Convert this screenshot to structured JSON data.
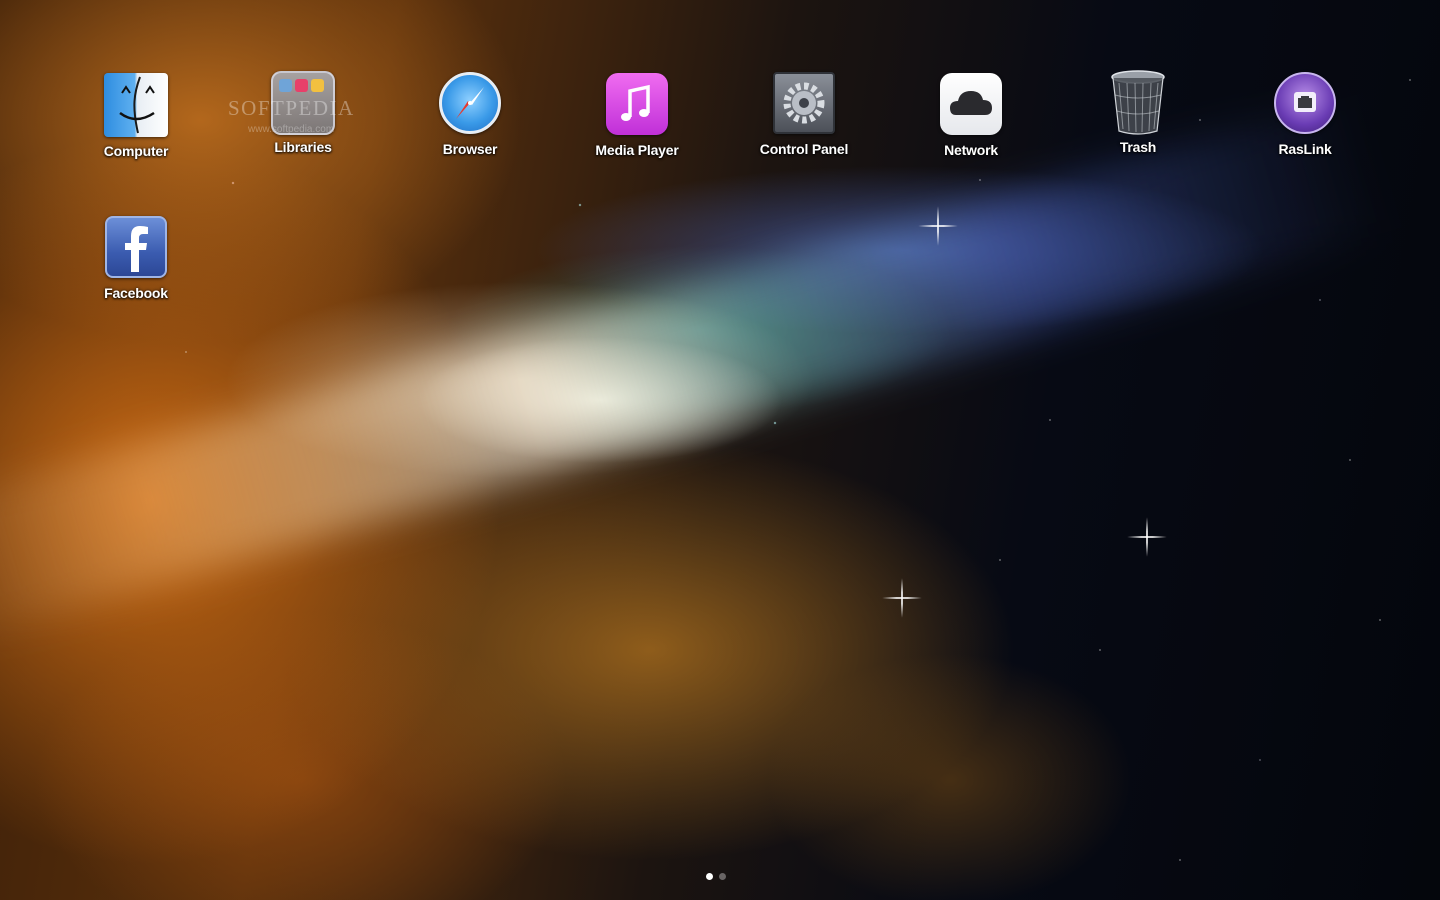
{
  "desktop": {
    "icons": [
      {
        "label": "Computer",
        "icon": "finder-icon"
      },
      {
        "label": "Libraries",
        "icon": "libraries-folder-icon"
      },
      {
        "label": "Browser",
        "icon": "safari-compass-icon"
      },
      {
        "label": "Media Player",
        "icon": "music-note-icon"
      },
      {
        "label": "Control Panel",
        "icon": "gear-icon"
      },
      {
        "label": "Network",
        "icon": "cloud-icon"
      },
      {
        "label": "Trash",
        "icon": "trash-can-icon"
      },
      {
        "label": "RasLink",
        "icon": "ethernet-port-icon"
      },
      {
        "label": "Facebook",
        "icon": "facebook-icon"
      }
    ],
    "watermark": {
      "text": "SOFTPEDIA",
      "url": "www.softpedia.com"
    },
    "page_indicator": {
      "current": 1,
      "total": 2
    },
    "colors": {
      "label_text": "#ffffff",
      "music_pink": "#e040e8",
      "facebook_blue": "#3b5cb0",
      "raslink_purple": "#6a3cb4"
    }
  }
}
